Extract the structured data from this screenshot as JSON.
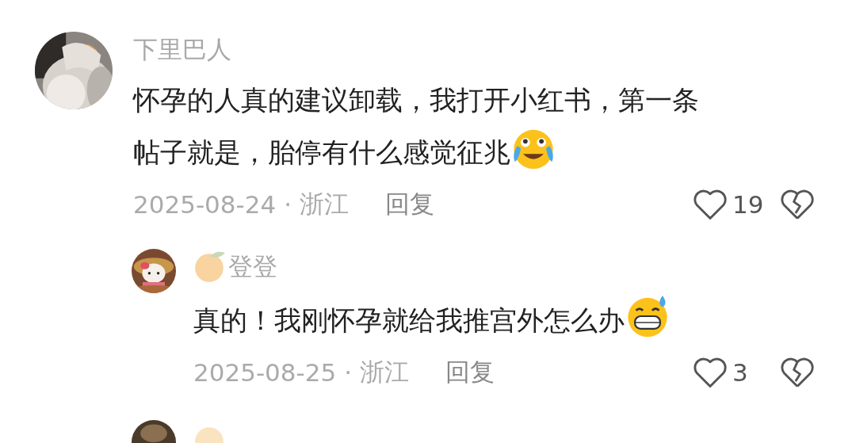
{
  "comments": [
    {
      "author": "下里巴人",
      "text_lines": [
        "怀孕的人真的建议卸载，我打开小红书，第一条",
        "帖子就是，胎停有什么感觉征兆"
      ],
      "emoji": {
        "kind": "tears-of-joy"
      },
      "date": "2025-08-24",
      "separator": "·",
      "location": "浙江",
      "reply": "回复",
      "likes": "19",
      "has_badge": false,
      "replies": [
        {
          "author": "登登",
          "has_badge": true,
          "text": "真的！我刚怀孕就给我推宫外怎么办",
          "emoji": {
            "kind": "grin-sweat"
          },
          "date": "2025-08-25",
          "separator": "·",
          "location": "浙江",
          "reply": "回复",
          "likes": "3"
        }
      ]
    }
  ],
  "cut_off_comment": {
    "has_badge": true
  }
}
